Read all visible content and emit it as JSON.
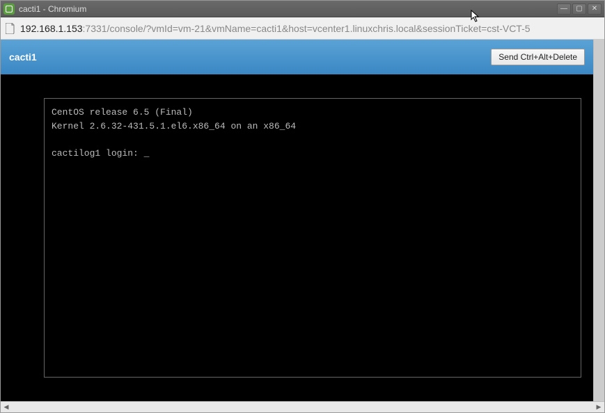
{
  "window": {
    "title": "cacti1 - Chromium",
    "controls": {
      "minimize": "—",
      "maximize": "▢",
      "close": "✕"
    }
  },
  "addressbar": {
    "host": "192.168.1.153",
    "port": ":7331",
    "path": "/console/?vmId=vm-21&vmName=cacti1&host=vcenter1.linuxchris.local&sessionTicket=cst-VCT-5"
  },
  "header": {
    "vm_name": "cacti1",
    "cad_button_label": "Send Ctrl+Alt+Delete"
  },
  "terminal": {
    "line1": "CentOS release 6.5 (Final)",
    "line2": "Kernel 2.6.32-431.5.1.el6.x86_64 on an x86_64",
    "line3": "",
    "prompt": "cactilog1 login: ",
    "cursor": "_"
  },
  "hscroll": {
    "left": "◀",
    "right": "▶"
  }
}
